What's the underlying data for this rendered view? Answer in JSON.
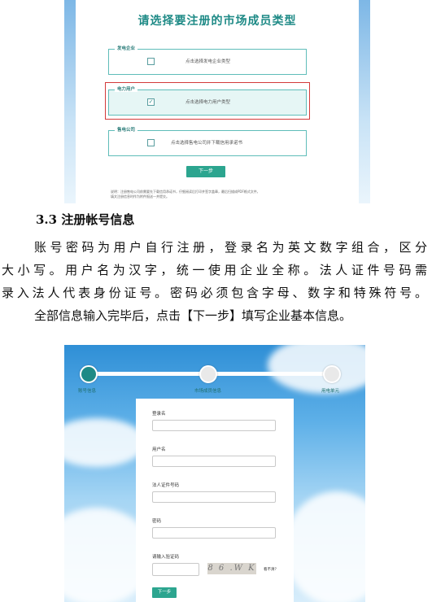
{
  "registration_type_screen": {
    "title": "请选择要注册的市场成员类型",
    "options": [
      {
        "legend": "发电企业",
        "text": "点击选择发电企业类型",
        "checked": false
      },
      {
        "legend": "电力用户",
        "text": "点击选择电力用户类型",
        "checked": true
      },
      {
        "legend": "售电公司",
        "text": "点击选择售电公司并下载信用承诺书",
        "checked": false
      }
    ],
    "checkmark": "✓",
    "next_button": "下一步",
    "note_line1": "说明：注册售电公司前需要先下载信用承诺书，仔细阅读后打印并签字盖章，最后扫描成PDF格式文件，",
    "note_line2": "填文注册信息时作为附件报送一并提交。"
  },
  "section": {
    "heading": "3.3  注册帐号信息",
    "lines": [
      "账号密码为用户自行注册，登录名为英文数字组合，区分",
      "大小写。用户名为汉字，统一使用企业全称。法人证件号码需",
      "录入法人代表身份证号。密码必须包含字母、数字和特殊符号。",
      "全部信息输入完毕后，点击【下一步】填写企业基本信息。"
    ]
  },
  "account_form_screen": {
    "steps": [
      "账号信息",
      "市场成员信息",
      "用电单元"
    ],
    "fields": [
      "登录名",
      "用户名",
      "法人证件号码",
      "密码"
    ],
    "captcha_label": "请输入验证码",
    "captcha_text": "8 6 .W K",
    "captcha_refresh": "看不清？",
    "next_button": "下一步"
  },
  "colors": {
    "accent": "#2ca58f",
    "title_teal": "#1e8a86",
    "highlight_red": "#d33a3a"
  }
}
